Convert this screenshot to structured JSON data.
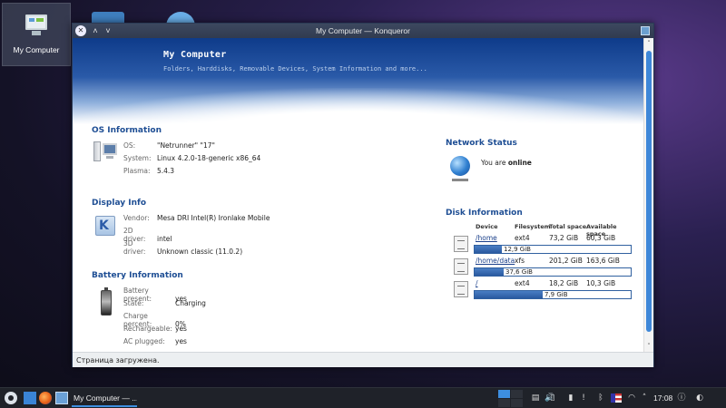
{
  "desktop": {
    "my_computer_label": "My Computer"
  },
  "window": {
    "title": "My Computer — Konqueror",
    "banner_title": "My Computer",
    "banner_subtitle": "Folders, Harddisks, Removable Devices, System Information and more...",
    "status_text": "Страница загружена."
  },
  "os_info": {
    "heading": "OS Information",
    "rows": [
      {
        "key": "OS:",
        "value": "\"Netrunner\" \"17\""
      },
      {
        "key": "System:",
        "value": "Linux 4.2.0-18-generic x86_64"
      },
      {
        "key": "Plasma:",
        "value": "5.4.3"
      }
    ]
  },
  "display_info": {
    "heading": "Display Info",
    "rows": [
      {
        "key": "Vendor:",
        "value": "Mesa DRI Intel(R) Ironlake Mobile"
      },
      {
        "key": "2D driver:",
        "value": "intel"
      },
      {
        "key": "3D driver:",
        "value": "Unknown classic (11.0.2)"
      }
    ]
  },
  "battery_info": {
    "heading": "Battery Information",
    "rows": [
      {
        "key": "Battery present:",
        "value": "yes"
      },
      {
        "key": "State:",
        "value": "Charging"
      },
      {
        "key": "Charge percent:",
        "value": "0%"
      },
      {
        "key": "Rechargeable:",
        "value": "yes"
      },
      {
        "key": "AC plugged:",
        "value": "yes"
      }
    ]
  },
  "network": {
    "heading": "Network Status",
    "prefix": "You are ",
    "state": "online"
  },
  "disks": {
    "heading": "Disk Information",
    "columns": [
      "Device",
      "Filesystem",
      "Total space",
      "Available space"
    ],
    "rows": [
      {
        "device": "/home",
        "fs": "ext4",
        "total": "73,2 GiB",
        "available": "60,3 GiB",
        "used": "12,9 GiB",
        "used_fraction": 0.176
      },
      {
        "device": "/home/data",
        "fs": "xfs",
        "total": "201,2 GiB",
        "available": "163,6 GiB",
        "used": "37,6 GiB",
        "used_fraction": 0.187
      },
      {
        "device": "/",
        "fs": "ext4",
        "total": "18,2 GiB",
        "available": "10,3 GiB",
        "used": "7,9 GiB",
        "used_fraction": 0.434
      }
    ]
  },
  "taskbar": {
    "task_label": "My Computer — ...",
    "clock": "17:08"
  }
}
